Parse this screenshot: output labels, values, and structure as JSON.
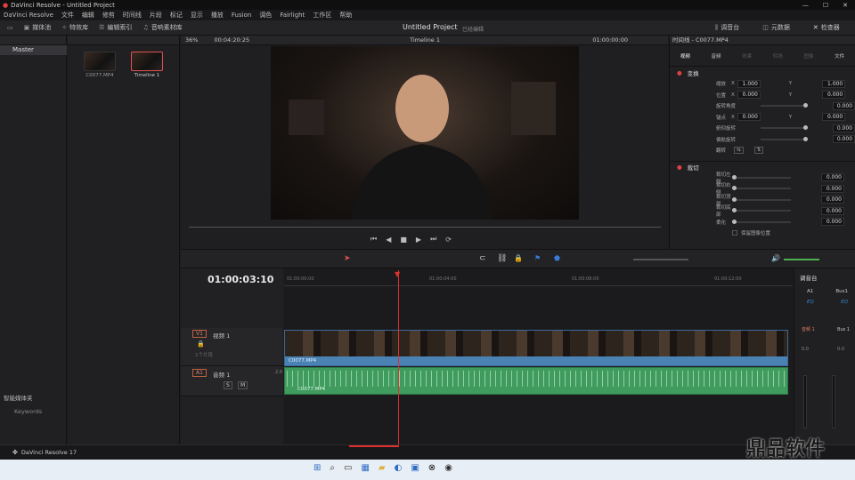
{
  "window": {
    "title": "DaVinci Resolve - Untitled Project",
    "min": "—",
    "max": "☐",
    "close": "✕"
  },
  "menu": [
    "DaVinci Resolve",
    "文件",
    "编辑",
    "修剪",
    "时间线",
    "片段",
    "标记",
    "显示",
    "播放",
    "Fusion",
    "调色",
    "Fairlight",
    "工作区",
    "帮助"
  ],
  "toolbar": {
    "media_pool": "媒体池",
    "effects": "特效库",
    "edit_index": "编辑索引",
    "sound_library": "音响素材库",
    "project_title": "Untitled Project",
    "project_sub": "已经编辑",
    "mixer": "调音台",
    "metadata": "元数据",
    "inspector": "检查器"
  },
  "viewer": {
    "zoom": "36%",
    "timecode_src": "00:04:20:25",
    "timeline_name": "Timeline 1",
    "timecode_dst": "01:00:00:00",
    "inspector_label": "时间线 - C0077.MP4"
  },
  "bins": {
    "master": "Master",
    "smart_bins": "智能媒体夹",
    "keywords": "Keywords"
  },
  "clips": [
    {
      "name": "C0077.MP4",
      "selected": false
    },
    {
      "name": "Timeline 1",
      "selected": true
    }
  ],
  "inspector": {
    "tabs": [
      "视频",
      "音频",
      "效果",
      "转场",
      "图像",
      "文件"
    ],
    "transform_title": "变换",
    "zoom_label": "缩放",
    "zoom_x": "1.000",
    "zoom_y": "1.000",
    "position_label": "位置",
    "pos_x": "0.000",
    "pos_y": "0.000",
    "rotation_label": "旋转角度",
    "rotation": "0.000",
    "anchor_label": "锚点",
    "anchor_x": "0.000",
    "anchor_y": "0.000",
    "pitch_label": "俯仰旋转",
    "pitch": "0.000",
    "yaw_label": "偏航旋转",
    "yaw": "0.000",
    "flip_label": "翻转",
    "crop_title": "裁切",
    "crop_left_label": "裁切左侧",
    "crop_left": "0.000",
    "crop_right_label": "裁切右侧",
    "crop_right": "0.000",
    "crop_top_label": "裁切顶部",
    "crop_top": "0.000",
    "crop_bottom_label": "裁切底部",
    "crop_bottom": "0.000",
    "soften_label": "柔化",
    "soften": "0.000",
    "retain_label": "保留图像位置"
  },
  "timeline": {
    "timecode": "01:00:03:10",
    "ruler": [
      "01:00:00:00",
      "01:00:04:00",
      "01:00:08:00",
      "01:00:12:00"
    ],
    "v1": {
      "tag": "V1",
      "name": "视频 1",
      "count": "1个片段",
      "clip": "C0077.MP4"
    },
    "a1": {
      "tag": "A1",
      "name": "音频 1",
      "level": "2.0",
      "clip": "C0077.MP4"
    }
  },
  "mixer": {
    "title": "调音台",
    "a1": "A1",
    "bus1": "Bus1",
    "eq": "EQ",
    "ch_a1": "音频 1",
    "ch_bus": "Bus 1",
    "db": "0.0",
    "db2": "0.0"
  },
  "bottom": {
    "app_name": "DaVinci Resolve 17"
  },
  "watermark": "鼎品软件"
}
